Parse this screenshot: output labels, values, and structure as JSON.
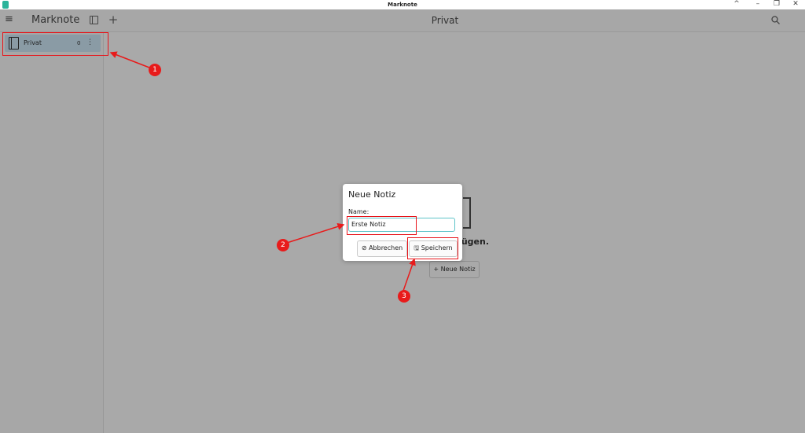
{
  "window": {
    "title": "Marknote"
  },
  "toolbar": {
    "app_name": "Marknote",
    "main_title": "Privat"
  },
  "sidebar": {
    "notebooks": [
      {
        "label": "Privat",
        "count": "0"
      }
    ]
  },
  "empty_state": {
    "text": "nzufügen.",
    "add_button_label": "Neue Notiz"
  },
  "dialog": {
    "title": "Neue Notiz",
    "name_label": "Name:",
    "name_value": "Erste Notiz",
    "cancel_label": "Abbrechen",
    "save_label": "Speichern"
  },
  "annotations": {
    "badges": [
      "1",
      "2",
      "3"
    ]
  },
  "colors": {
    "annotation_red": "#e81b1b",
    "accent": "#2bb39a",
    "input_focus": "#5ec4c9",
    "selected_item": "#8a9ba5"
  }
}
